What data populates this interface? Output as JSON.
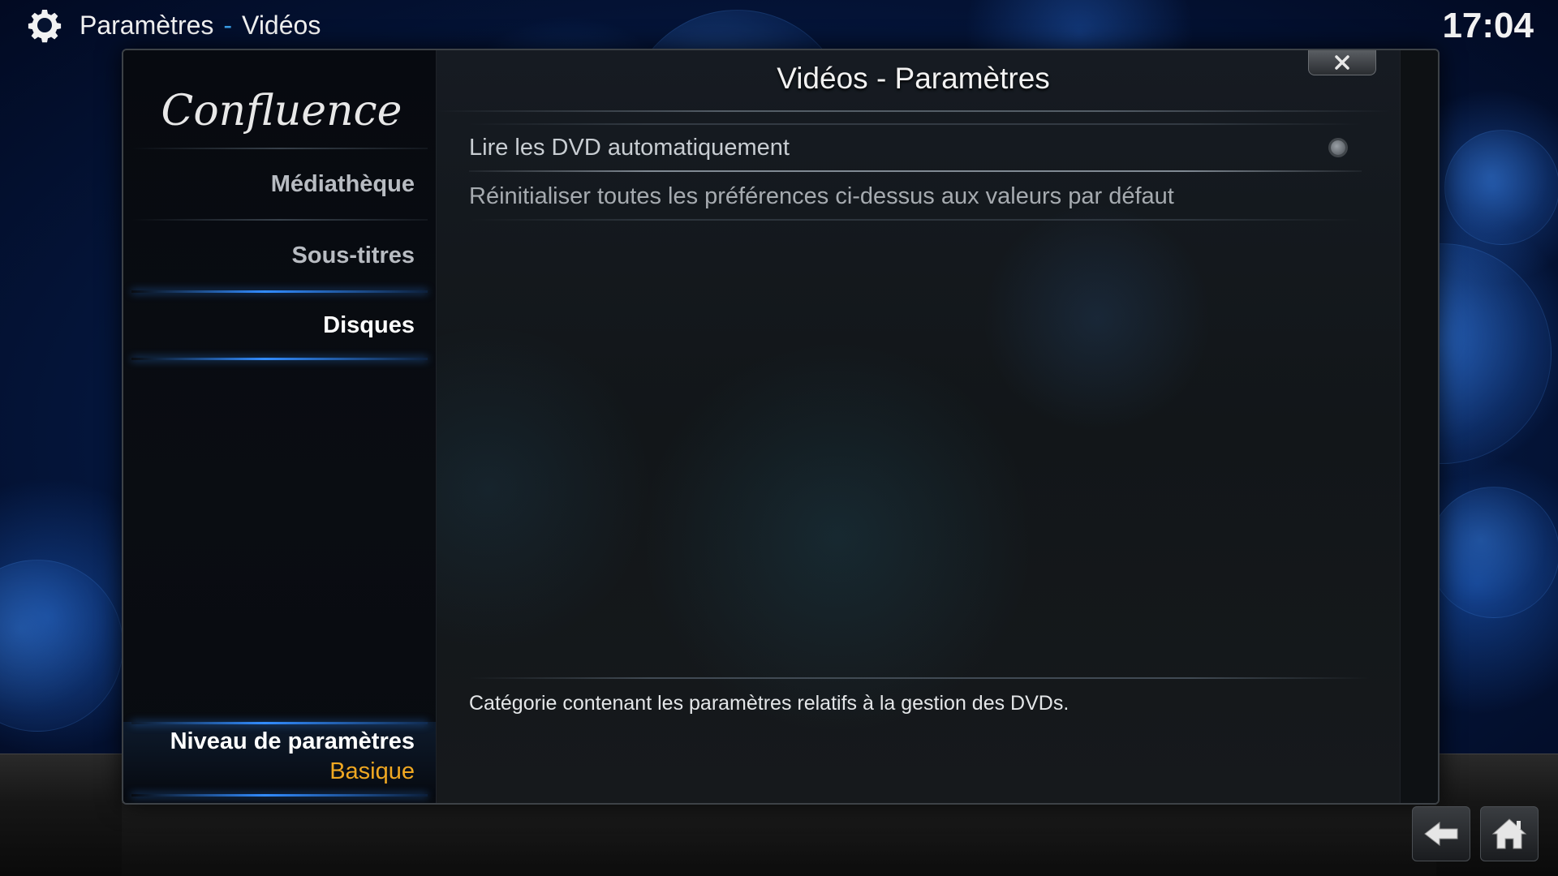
{
  "header": {
    "section": "Paramètres",
    "separator": "-",
    "subsection": "Vidéos",
    "clock": "17:04"
  },
  "sidebar": {
    "logo_text": "Confluence",
    "items": [
      {
        "label": "Médiathèque"
      },
      {
        "label": "Sous-titres"
      },
      {
        "label": "Disques"
      }
    ],
    "active_index": 2,
    "settings_level": {
      "label": "Niveau de paramètres",
      "value": "Basique"
    }
  },
  "dialog": {
    "title": "Vidéos - Paramètres",
    "settings": [
      {
        "label": "Lire les DVD automatiquement",
        "control": "radio",
        "enabled": false
      },
      {
        "label": "Réinitialiser toutes les préférences ci-dessus aux valeurs par défaut",
        "control": "none"
      }
    ],
    "description": "Catégorie contenant les paramètres relatifs à la gestion des DVDs."
  },
  "icons": {
    "header": "gear-icon",
    "close": "close-icon",
    "back": "back-arrow-icon",
    "home": "home-icon"
  },
  "colors": {
    "accent_blue": "#3a9fe8",
    "level_value": "#f0a822",
    "text_primary": "#f2f2f2",
    "text_muted": "#a6abb0"
  }
}
